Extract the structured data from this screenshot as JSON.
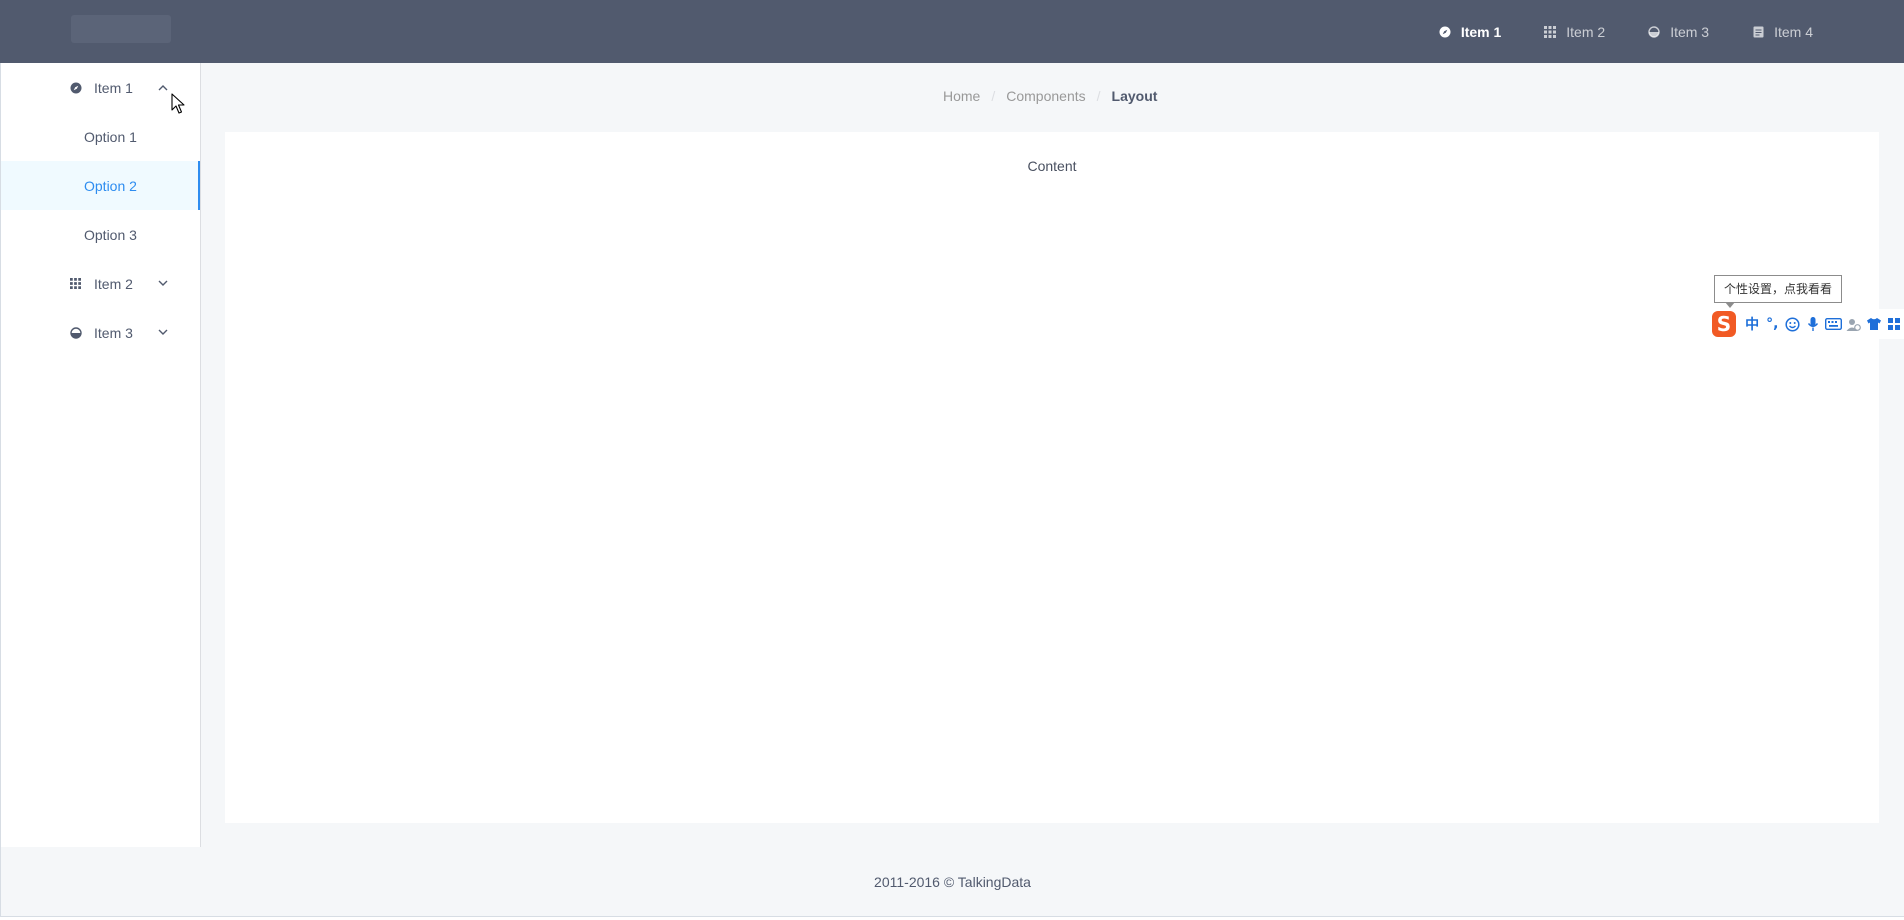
{
  "header": {
    "nav": [
      {
        "label": "Item 1",
        "icon": "compass-icon",
        "active": true
      },
      {
        "label": "Item 2",
        "icon": "grid-icon",
        "active": false
      },
      {
        "label": "Item 3",
        "icon": "pie-chart-icon",
        "active": false
      },
      {
        "label": "Item 4",
        "icon": "document-icon",
        "active": false
      }
    ]
  },
  "sidebar": {
    "groups": [
      {
        "label": "Item 1",
        "icon": "compass-icon",
        "expanded": true,
        "options": [
          {
            "label": "Option 1",
            "active": false
          },
          {
            "label": "Option 2",
            "active": true
          },
          {
            "label": "Option 3",
            "active": false
          }
        ]
      },
      {
        "label": "Item 2",
        "icon": "grid-icon",
        "expanded": false
      },
      {
        "label": "Item 3",
        "icon": "pie-chart-icon",
        "expanded": false
      }
    ]
  },
  "breadcrumb": {
    "items": [
      "Home",
      "Components",
      "Layout"
    ],
    "separator": "/"
  },
  "content": {
    "text": "Content"
  },
  "footer": {
    "text": "2011-2016 © TalkingData"
  },
  "ime": {
    "tooltip": "个性设置，点我看看",
    "logo": "S",
    "mode": "中",
    "punct": "°,"
  },
  "colors": {
    "header_bg": "#515a6e",
    "accent": "#2d8cf0",
    "page_bg": "#f5f7f9",
    "ime_orange": "#f15a24"
  }
}
